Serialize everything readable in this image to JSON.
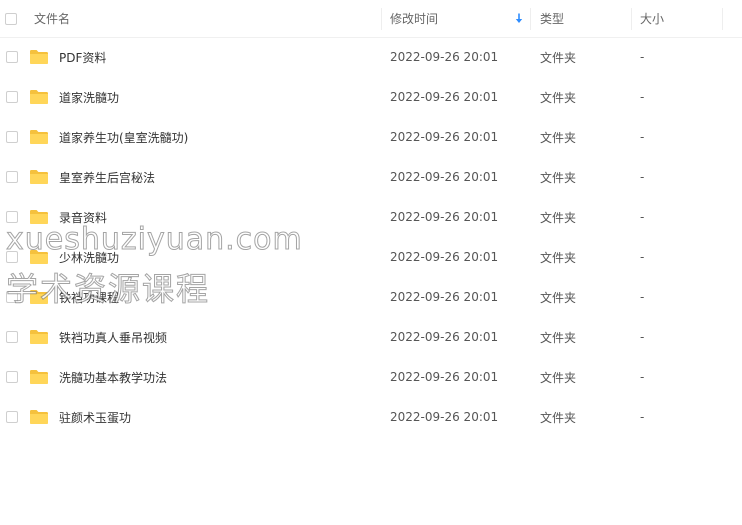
{
  "header": {
    "name_label": "文件名",
    "date_label": "修改时间",
    "type_label": "类型",
    "size_label": "大小"
  },
  "colors": {
    "folder": "#FFD659",
    "folder_tab": "#F5C13D",
    "sort_arrow": "#2E8DFF"
  },
  "files": [
    {
      "name": "PDF资料",
      "modified": "2022-09-26 20:01",
      "type": "文件夹",
      "size": "-"
    },
    {
      "name": "道家洗髓功",
      "modified": "2022-09-26 20:01",
      "type": "文件夹",
      "size": "-"
    },
    {
      "name": "道家养生功(皇室洗髓功)",
      "modified": "2022-09-26 20:01",
      "type": "文件夹",
      "size": "-"
    },
    {
      "name": "皇室养生后宫秘法",
      "modified": "2022-09-26 20:01",
      "type": "文件夹",
      "size": "-"
    },
    {
      "name": "录音资料",
      "modified": "2022-09-26 20:01",
      "type": "文件夹",
      "size": "-"
    },
    {
      "name": "少林洗髓功",
      "modified": "2022-09-26 20:01",
      "type": "文件夹",
      "size": "-"
    },
    {
      "name": "铁裆功课程",
      "modified": "2022-09-26 20:01",
      "type": "文件夹",
      "size": "-"
    },
    {
      "name": "铁裆功真人垂吊视频",
      "modified": "2022-09-26 20:01",
      "type": "文件夹",
      "size": "-"
    },
    {
      "name": "洗髓功基本教学功法",
      "modified": "2022-09-26 20:01",
      "type": "文件夹",
      "size": "-"
    },
    {
      "name": "驻颜术玉蛋功",
      "modified": "2022-09-26 20:01",
      "type": "文件夹",
      "size": "-"
    }
  ],
  "watermark": {
    "line1": "xueshuziyuan.com",
    "line2": "学术资源课程"
  }
}
